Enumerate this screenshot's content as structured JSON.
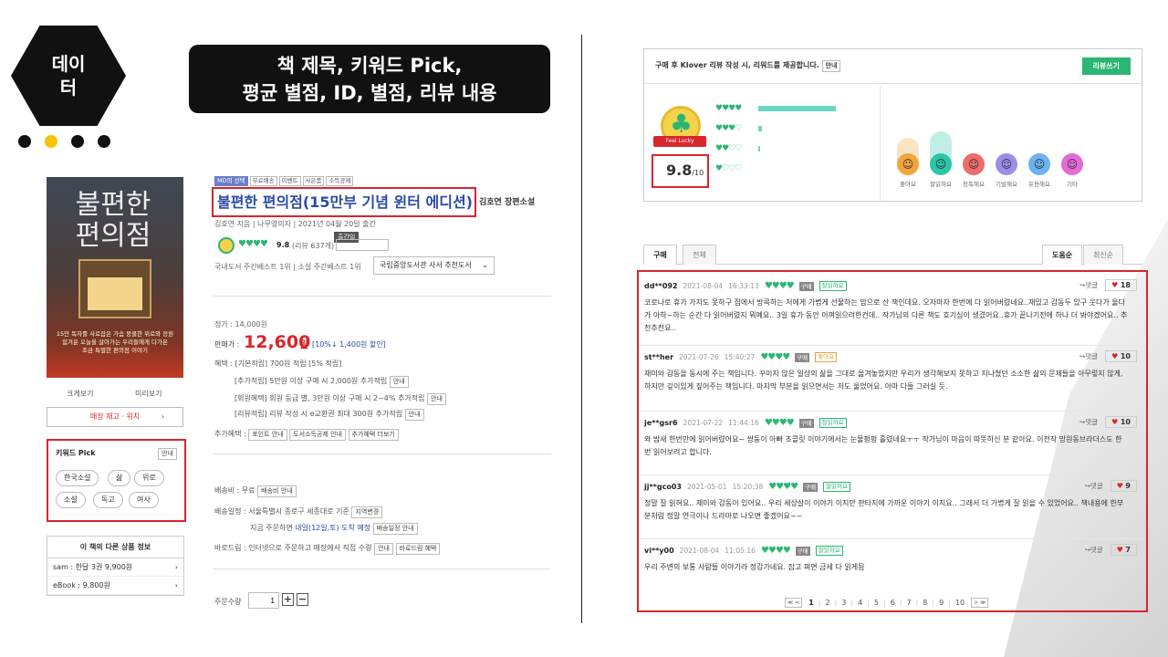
{
  "slide": {
    "hex_label": "데이\n터",
    "title_line1": "책 제목, 키워드 Pick,",
    "title_line2": "평균 별점, ID, 별점, 리뷰 내용"
  },
  "book": {
    "cover_title": "불편한\n편의점",
    "cover_subtitle": "15만 독자를 사로잡은 가슴 뭉클한 위로와 응원\n힘겨운 오늘을 살아가는 우리들에게 다가온\n조금 특별한 편의점 이야기",
    "view_large": "크게보기",
    "preview": "미리보기",
    "stock_button": "매장 재고 · 위치",
    "tags": [
      "MD의 선택",
      "무료배송",
      "이벤트",
      "사은품",
      "소득공제"
    ],
    "title": "불편한 편의점(15만부 기념 윈터 에디션)",
    "subtitle": "김호연 장편소설",
    "author_line": "김호연 지음 | 나무옆의자 | 2021년 04월 20일 출간",
    "rating_value": "9.8",
    "rating_count": "(리뷰 637개)",
    "tooltip": "출간일",
    "bestseller_line": "국내도서 주간베스트 1위 | 소설 주간베스트 1위",
    "recommend_select": "국립중앙도서관 사서 추천도서",
    "list_price": "정가 : 14,000원",
    "sale_label": "판매가 :",
    "sale_price": "12,600",
    "sale_unit": "원",
    "discount": "[10%↓ 1,400원 할인]",
    "benefit_label": "혜택 : [기본적립] 700원 적립 [5% 적립]",
    "benefit1": "[추가적립] 5만원 이상 구매 시 2,000원 추가적립",
    "benefit2": "[회원혜택] 회원 등급 별, 3만원 이상 구매 시 2~4% 추가적립",
    "benefit3": "[리뷰적립] 리뷰 작성 시 e교환권 최대 300원 추가적립",
    "info_btn": "안내",
    "extra_label": "추가혜택 :",
    "extra_btns": [
      "포인트 안내",
      "도서소득공제 안내",
      "추가혜택 더보기"
    ],
    "shipping_fee": "배송비 : 무료",
    "shipping_fee_btn": "배송비 안내",
    "shipping_sched": "배송일정 : 서울특별시 종로구 세종대로 기준",
    "region_btn": "지역변경",
    "order_line_prefix": "지금 주문하면",
    "order_line_date": "내일(12일,토) 도착 예정",
    "sched_btn": "배송일정 안내",
    "barodrim": "바로드림 : 인터넷으로 주문하고 매장에서 직접 수령",
    "barodrim_btn": "바로드림 혜택",
    "qty_label": "주문수량",
    "qty_value": "1"
  },
  "keyword_pick": {
    "title": "키워드 Pick",
    "info": "안내",
    "keywords": [
      "한국소설",
      "삶",
      "위로",
      "소설",
      "독고",
      "여사"
    ]
  },
  "other_products": {
    "title": "이 책의 다른 상품 정보",
    "items": [
      {
        "label": "sam : 한달 3권 9,900원"
      },
      {
        "label": "eBook : 9,800원"
      }
    ]
  },
  "klover": {
    "notice": "구매 후 Klover 리뷰 작성 시, 리워드를 제공합니다.",
    "info": "안내",
    "write_btn": "리뷰쓰기",
    "badge": "Feel Lucky",
    "score": "9.8",
    "score_max": "/10",
    "dist": [
      {
        "hearts": "♥♥♥♥",
        "ratio": 1.0
      },
      {
        "hearts": "♥♥♥♡",
        "ratio": 0.05
      },
      {
        "hearts": "♥♥♡♡",
        "ratio": 0.02
      },
      {
        "hearts": "♥♡♡♡",
        "ratio": 0.0
      }
    ],
    "emotions": [
      {
        "label": "좋아요",
        "color": "#f2a53a",
        "face": "☺",
        "level": 0.75
      },
      {
        "label": "잘읽혀요",
        "color": "#2bc6a8",
        "face": "☺",
        "level": 1.0
      },
      {
        "label": "정독해요",
        "color": "#f06b6b",
        "face": "☺",
        "level": 0.0
      },
      {
        "label": "기발해요",
        "color": "#9a8ee8",
        "face": "☺",
        "level": 0.0
      },
      {
        "label": "유용해요",
        "color": "#6bb2f0",
        "face": "☺",
        "level": 0.0
      },
      {
        "label": "기타",
        "color": "#e46ad6",
        "face": "☺",
        "level": 0.0
      }
    ]
  },
  "review_tabs": {
    "tabs": [
      "구매",
      "전체"
    ],
    "sort": [
      "도움순",
      "최신순"
    ]
  },
  "reviews": [
    {
      "id": "dd**092",
      "date": "2021-08-04",
      "time": "16:33:13",
      "hearts": "♥♥♥♥",
      "type": "구매",
      "emotion": "잘읽혀요",
      "emo_style": "",
      "reply": "↪댓글",
      "likes": "18",
      "body": "코로나로 휴가 가지도 못하구 집에서 방콕하는 저에게 가볍게 선물하는 맘으로 산 책인데요. 오자마자 한번에 다 읽어버렸네요..재밌고 감동두 있구 웃다가 울다가 아하~하는 순간 다 읽어버렸지 뭐예요.. 3일 휴가 동안 아껴읽으려한건데.. 작가님의 다른 책도 호기심이 생겼어요..휴가 끝나기전에 하나 더 봐야겠어요.. 추천추천요.."
    },
    {
      "id": "st**her",
      "date": "2021-07-26",
      "time": "15:40:27",
      "hearts": "♥♥♥♥",
      "type": "구매",
      "emotion": "좋아요",
      "emo_style": "o",
      "reply": "↪댓글",
      "likes": "10",
      "body": "재미와 감동을 동시에 주는 책입니다. 꾸미지 않은 일상의 삶을 그대로 옮겨놓았지만 우리가 생각해보지 못하고 지나쳤던 소소한 삶의 문제들을 아무렇지 않게, 하지만 깊이있게 짚어주는 책입니다. 마지막 부분을 읽으면서는 저도 울었어요. 아마 다들 그러실 듯."
    },
    {
      "id": "je**gsr6",
      "date": "2021-07-22",
      "time": "11:44:16",
      "hearts": "♥♥♥♥",
      "type": "구매",
      "emotion": "잘읽혀요",
      "emo_style": "",
      "reply": "↪댓글",
      "likes": "10",
      "body": "와 밤새 한번만에 읽어버렸어요~ 쌍둥이 아빠 초콜릿 이야기에서는 눈물펑펑 흘렸네요ㅜㅜ 작가님이 마음이 따뜻하신 분 같아요. 이전작 망원동브라더스도 한 번 읽어보려고 합니다."
    },
    {
      "id": "jj**gco03",
      "date": "2021-05-01",
      "time": "15:20:38",
      "hearts": "♥♥♥♥",
      "type": "구매",
      "emotion": "잘읽혀요",
      "emo_style": "",
      "reply": "↪댓글",
      "likes": "9",
      "body": "정말 잘 읽혀요.. 재미와 감동이 있어요.. 우리 세상살이 이야기 이지만 판타지에 가까운 이야기 이지요.. 그래서 더 가볍게 잘 읽을 수 있었어요.. 책내용에 한부분처럼 정말 연극이나 드라마로 나오면 좋겠어요~~"
    },
    {
      "id": "vi**y00",
      "date": "2021-08-04",
      "time": "11:05:16",
      "hearts": "♥♥♥♥",
      "type": "구매",
      "emotion": "잘읽혀요",
      "emo_style": "",
      "reply": "↪댓글",
      "likes": "7",
      "body": "우리 주변의 보통 사람들 이야기라 정감가네요. 잡고 펴면 금세 다 읽게됨"
    }
  ],
  "pager": {
    "prev": "≪ <",
    "pages": [
      "1",
      "2",
      "3",
      "4",
      "5",
      "6",
      "7",
      "8",
      "9",
      "10"
    ],
    "next": "> ≫"
  },
  "colors": {
    "accent_red": "#d8262a",
    "green": "#2bb673",
    "title_blue": "#2b4aa6"
  }
}
